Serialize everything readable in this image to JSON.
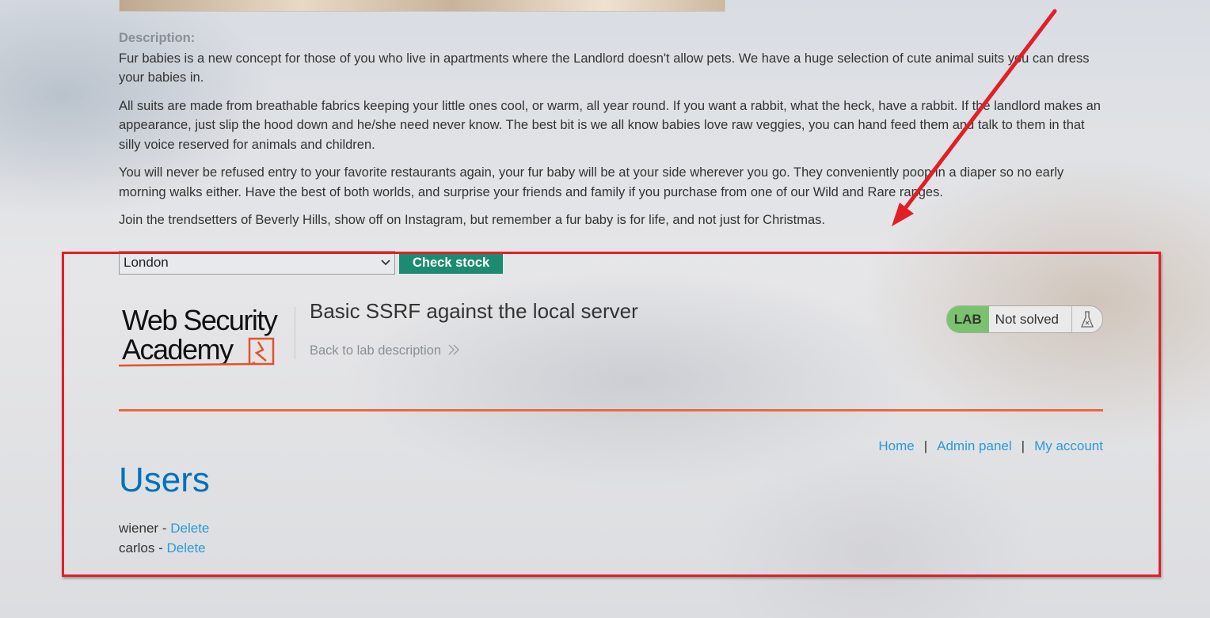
{
  "product": {
    "description_label": "Description:",
    "paragraphs": [
      "Fur babies is a new concept for those of you who live in apartments where the Landlord doesn't allow pets. We have a huge selection of cute animal suits you can dress your babies in.",
      "All suits are made from breathable fabrics keeping your little ones cool, or warm, all year round. If you want a rabbit, what the heck, have a rabbit. If the landlord makes an appearance, just slip the hood down and he/she need never know. The best bit is we all know babies love raw veggies, you can hand feed them and talk to them in that silly voice reserved for animals and children.",
      "You will never be refused entry to your favorite restaurants again, your fur baby will be at your side wherever you go. They conveniently poop in a diaper so no early morning walks either. Have the best of both worlds, and surprise your friends and family if you purchase from one of our Wild and Rare ranges.",
      "Join the trendsetters of Beverly Hills, show off on Instagram, but remember a fur baby is for life, and not just for Christmas."
    ]
  },
  "stock_check": {
    "selected_store": "London",
    "button_label": "Check stock"
  },
  "lab": {
    "logo_line1": "Web Security",
    "logo_line2": "Academy",
    "title": "Basic SSRF against the local server",
    "back_link": "Back to lab description",
    "status_tag": "LAB",
    "status_text": "Not solved"
  },
  "nav": {
    "home": "Home",
    "separator": "|",
    "admin_panel": "Admin panel",
    "my_account": "My account"
  },
  "users": {
    "title": "Users",
    "list": [
      {
        "name": "wiener",
        "dash": "-",
        "action": "Delete"
      },
      {
        "name": "carlos",
        "dash": "-",
        "action": "Delete"
      }
    ]
  },
  "colors": {
    "accent_orange": "#f0663c",
    "button_green": "#1d8b72",
    "link_blue": "#2a9ad8",
    "heading_blue": "#0071bc",
    "annotation_red": "#e21f26",
    "lab_tag_green": "#7bc26f"
  }
}
